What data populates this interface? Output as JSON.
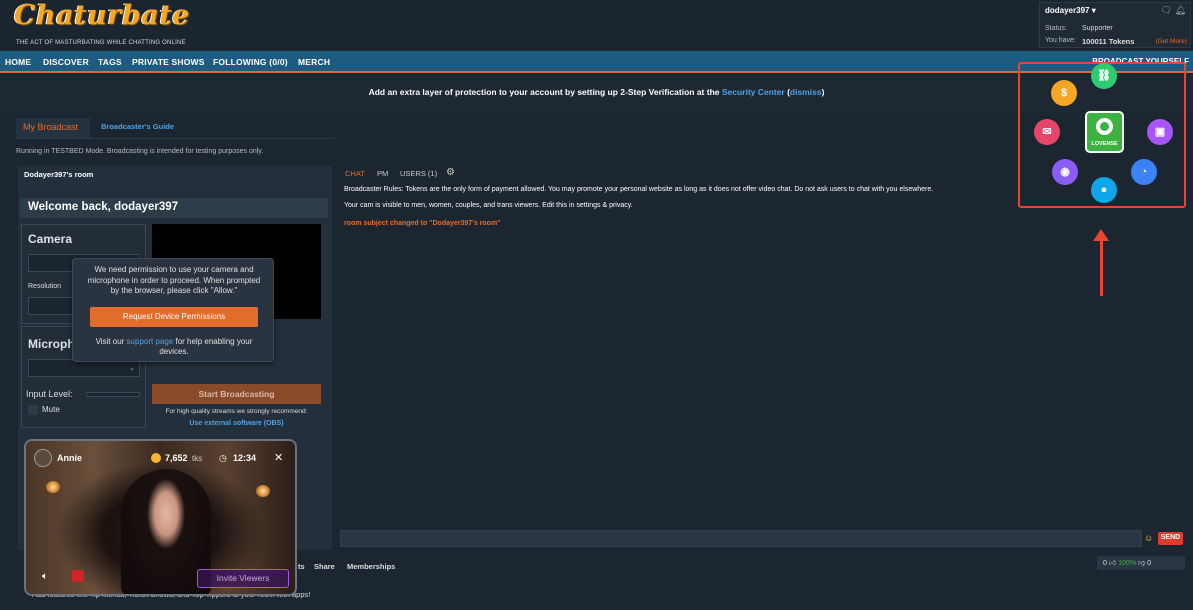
{
  "header": {
    "logo": "Chaturbate",
    "tagline": "THE ACT OF MASTURBATING WHILE CHATTING ONLINE"
  },
  "user": {
    "username": "dodayer397 ▾",
    "status_label": "Status:",
    "status_value": "Supporter",
    "have_label": "You have:",
    "tokens": "100011 Tokens",
    "get_more": "(Get More)"
  },
  "nav": {
    "items": [
      "HOME",
      "DISCOVER",
      "TAGS",
      "PRIVATE SHOWS",
      "FOLLOWING (0/0)",
      "MERCH"
    ],
    "broadcast": "BROADCAST YOURSELF"
  },
  "banner": {
    "text": "Add an extra layer of protection to your account by setting up 2-Step Verification at the ",
    "link": "Security Center",
    "open_paren": " (",
    "dismiss": "dismiss",
    "close_paren": ")"
  },
  "tabs": {
    "my_broadcast": "My Broadcast",
    "guide": "Broadcaster's Guide"
  },
  "testbed_notice": "Running in TESTBED Mode. Broadcasting is intended for testing purposes only.",
  "room": {
    "title": "Dodayer397's room",
    "welcome": "Welcome back, dodayer397"
  },
  "camera": {
    "title": "Camera",
    "resolution_label": "Resolution"
  },
  "mic": {
    "title": "Microph",
    "input_level": "Input Level:",
    "mute": "Mute"
  },
  "permission_popup": {
    "message": "We need permission to use your camera and microphone in order to proceed. When prompted by the browser, please click \"Allow.\"",
    "button": "Request Device Permissions",
    "visit_pre": "Visit our ",
    "visit_link": "support page",
    "visit_post": " for help enabling your devices."
  },
  "broadcast": {
    "start": "Start Broadcasting",
    "hq_note": "For high quality streams we strongly recommend:",
    "obs_link": "Use external software (OBS)"
  },
  "chat": {
    "tabs": [
      "CHAT",
      "PM",
      "USERS (1)"
    ],
    "rules": "Broadcaster Rules: Tokens are the only form of payment allowed. You may promote your personal website as long as it does not offer video chat. Do not ask users to chat with you elsewhere.",
    "visibility": "Your cam is visible to men, women, couples, and trans viewers. Edit this in settings & privacy.",
    "subject_change": "room subject changed to \"Dodayer397's room\"",
    "send": "SEND"
  },
  "bottom": {
    "tabs": [
      "ts",
      "Share",
      "Memberships"
    ],
    "votes_up": "0",
    "votes_pct": "100%",
    "votes_down": "0",
    "apps_text": "Add features like Tip Menus, Ticket Shows, and Top Tippers to your room with apps!"
  },
  "viewer_card": {
    "name": "Annie",
    "tokens": "7,652",
    "tokens_unit": "tks",
    "time": "12:34",
    "invite": "Invite Viewers"
  },
  "launcher": {
    "lovense_label": "LOVENSE",
    "icons": [
      "dollar-icon",
      "link-icon",
      "wechat-icon",
      "tv-icon",
      "discord-icon",
      "messenger-icon",
      "camera-icon"
    ],
    "colors": {
      "dollar": "#f5a623",
      "link": "#2ecc71",
      "wechat": "#e8456b",
      "tv": "#a855f7",
      "discord": "#8b5cf6",
      "messenger": "#3b82f6",
      "camera": "#0ea5e9",
      "lovense": "#3cb340",
      "highlight": "#e8452c"
    }
  }
}
